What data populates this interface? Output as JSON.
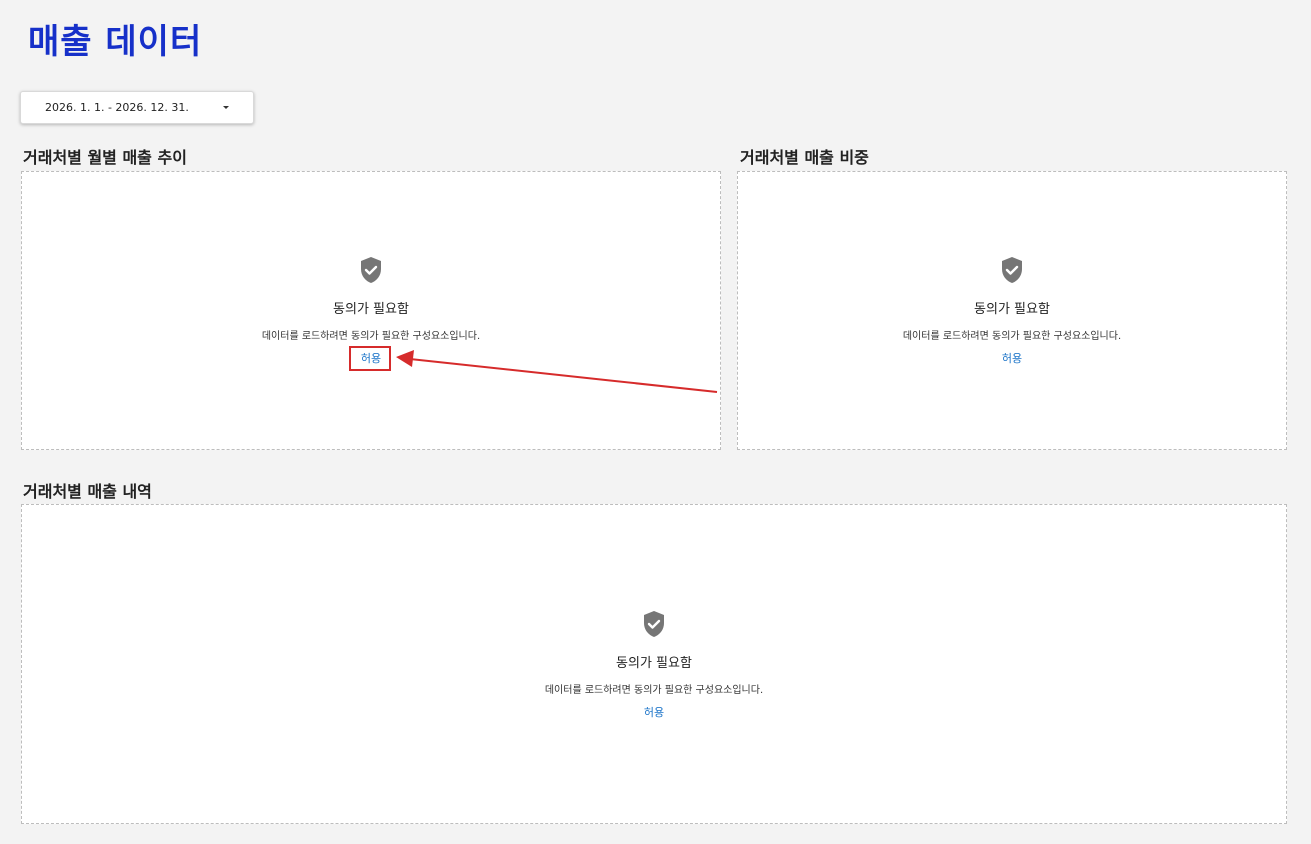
{
  "page": {
    "title": "매출 데이터"
  },
  "date_filter": {
    "value": "2026. 1. 1. - 2026. 12. 31."
  },
  "sections": [
    {
      "title": "거래처별 월별 매출 추이",
      "consent": {
        "title": "동의가 필요함",
        "description": "데이터를 로드하려면 동의가 필요한 구성요소입니다.",
        "allow_label": "허용"
      }
    },
    {
      "title": "거래처별 매출 비중",
      "consent": {
        "title": "동의가 필요함",
        "description": "데이터를 로드하려면 동의가 필요한 구성요소입니다.",
        "allow_label": "허용"
      }
    },
    {
      "title": "거래처별 매출 내역",
      "consent": {
        "title": "동의가 필요함",
        "description": "데이터를 로드하려면 동의가 필요한 구성요소입니다.",
        "allow_label": "허용"
      }
    }
  ],
  "icons": {
    "consent": "shield-check-icon",
    "dropdown": "caret-down-icon"
  },
  "colors": {
    "title": "#1630c9",
    "link": "#1a73c8",
    "annotation": "#d62b2b",
    "icon": "#767676"
  }
}
